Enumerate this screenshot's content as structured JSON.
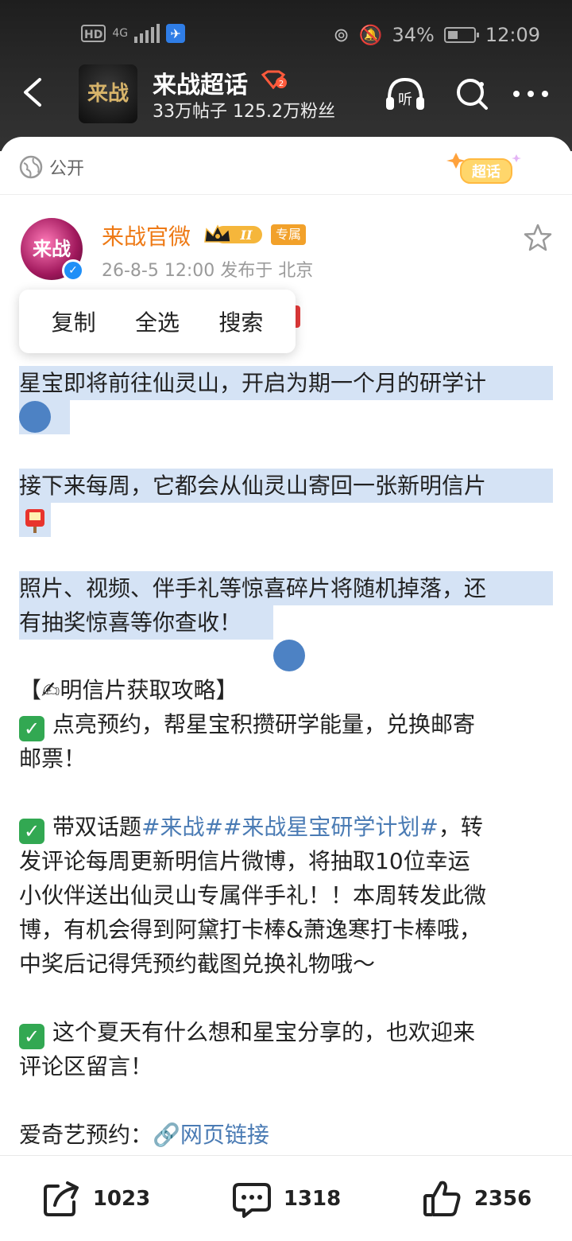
{
  "status_bar": {
    "network": "4G",
    "battery": "34%",
    "time": "12:09"
  },
  "header": {
    "title": "来战超话",
    "stats": "33万帖子 125.2万粉丝",
    "logo_text": "来战",
    "listen_label": "听"
  },
  "card": {
    "visibility": "公开",
    "chaohua_badge": "超话",
    "author": {
      "name": "来战官微",
      "level": "II",
      "exclusive_tag": "专属",
      "avatar_text": "来战",
      "meta": "26-8-5 12:00  发布于 北京"
    },
    "context_menu": {
      "copy": "复制",
      "select_all": "全选",
      "search": "搜索"
    },
    "paragraphs": {
      "p1": "星宝即将前往仙灵山，开启为期一个月的研学计",
      "p2": "接下来每周，它都会从仙灵山寄回一张新明信片",
      "p3_l1": "照片、视频、伴手礼等惊喜碎片将随机掉落，还",
      "p3_l2": "有抽奖惊喜等你查收！",
      "guide_title": "【✍明信片获取攻略】",
      "b1_l1": "点亮预约，帮星宝积攒研学能量，兑换邮寄",
      "b1_l2": "邮票！",
      "b2_l1_pre": "带双话题",
      "b2_tag1": "#来战#",
      "b2_tag2": "#来战星宝研学计划#",
      "b2_l1_post": "，转",
      "b2_l2": "发评论每周更新明信片微博，将抽取10位幸运",
      "b2_l3": "小伙伴送出仙灵山专属伴手礼！！本周转发此微",
      "b2_l4": "博，有机会得到阿黛打卡棒&萧逸寒打卡棒哦，",
      "b2_l5": "中奖后记得凭预约截图兑换礼物哦～",
      "b3_l1": "这个夏天有什么想和星宝分享的，也欢迎来",
      "b3_l2": "评论区留言！",
      "preorder_label": "爱奇艺预约：",
      "link_text": "网页链接"
    }
  },
  "actions": {
    "repost_count": "1023",
    "comment_count": "1318",
    "like_count": "2356"
  },
  "colors": {
    "accent_orange": "#ee7a16",
    "link_blue": "#4a7bb4",
    "selection": "#d5e3f5",
    "handle": "#4d82c4"
  }
}
